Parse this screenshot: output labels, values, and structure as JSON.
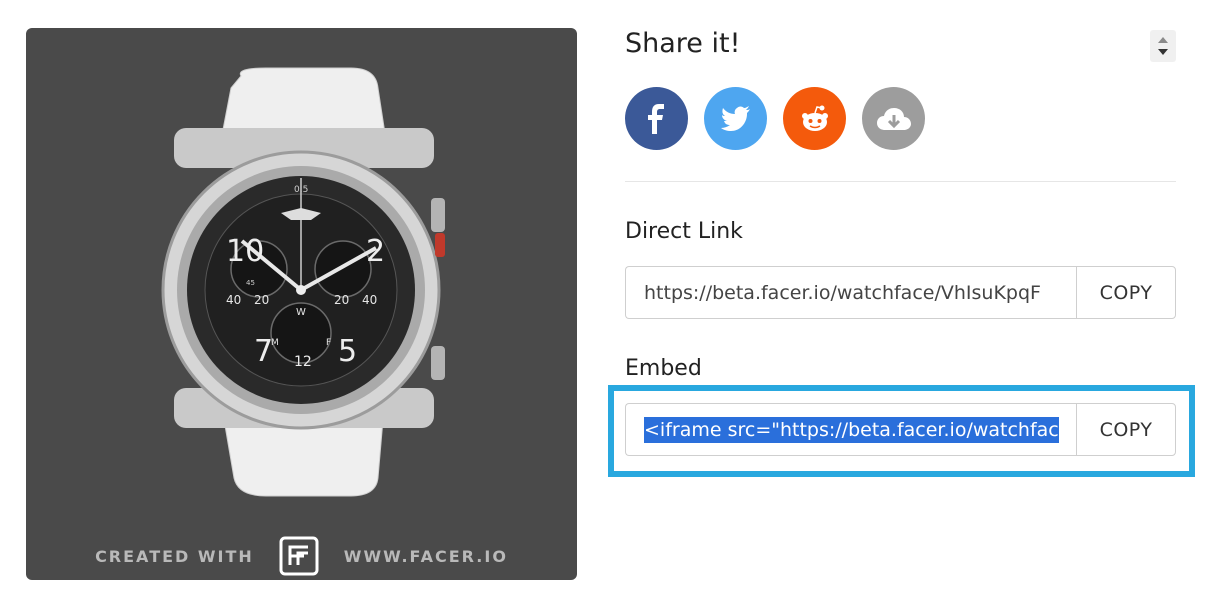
{
  "preview": {
    "footer_left": "CREATED WITH",
    "footer_right": "WWW.FACER.IO",
    "logo_icon": "facer-logo-icon",
    "watch": {
      "top_numbers": [
        "10",
        "2"
      ],
      "bottom_numbers": [
        "7",
        "5"
      ],
      "subdial_left": [
        "40",
        "20"
      ],
      "subdial_right": [
        "20",
        "40"
      ],
      "center_labels": [
        "W",
        "M",
        "F",
        "12"
      ],
      "inner_ring_small": [
        "0.5",
        "45"
      ]
    }
  },
  "share": {
    "title": "Share it!",
    "sort_icon": "sort-updown-icon",
    "buttons": [
      {
        "name": "facebook",
        "icon": "facebook-icon",
        "color": "#3b5998"
      },
      {
        "name": "twitter",
        "icon": "twitter-icon",
        "color": "#4ea6f0"
      },
      {
        "name": "reddit",
        "icon": "reddit-icon",
        "color": "#f45a0c"
      },
      {
        "name": "download",
        "icon": "cloud-download-icon",
        "color": "#9d9d9d"
      }
    ]
  },
  "direct_link": {
    "label": "Direct Link",
    "value": "https://beta.facer.io/watchface/VhIsuKpqF",
    "copy_label": "COPY"
  },
  "embed": {
    "label": "Embed",
    "value": "<iframe src=\"https://beta.facer.io/watchfac",
    "copy_label": "COPY",
    "highlight_color": "#29a8df"
  }
}
